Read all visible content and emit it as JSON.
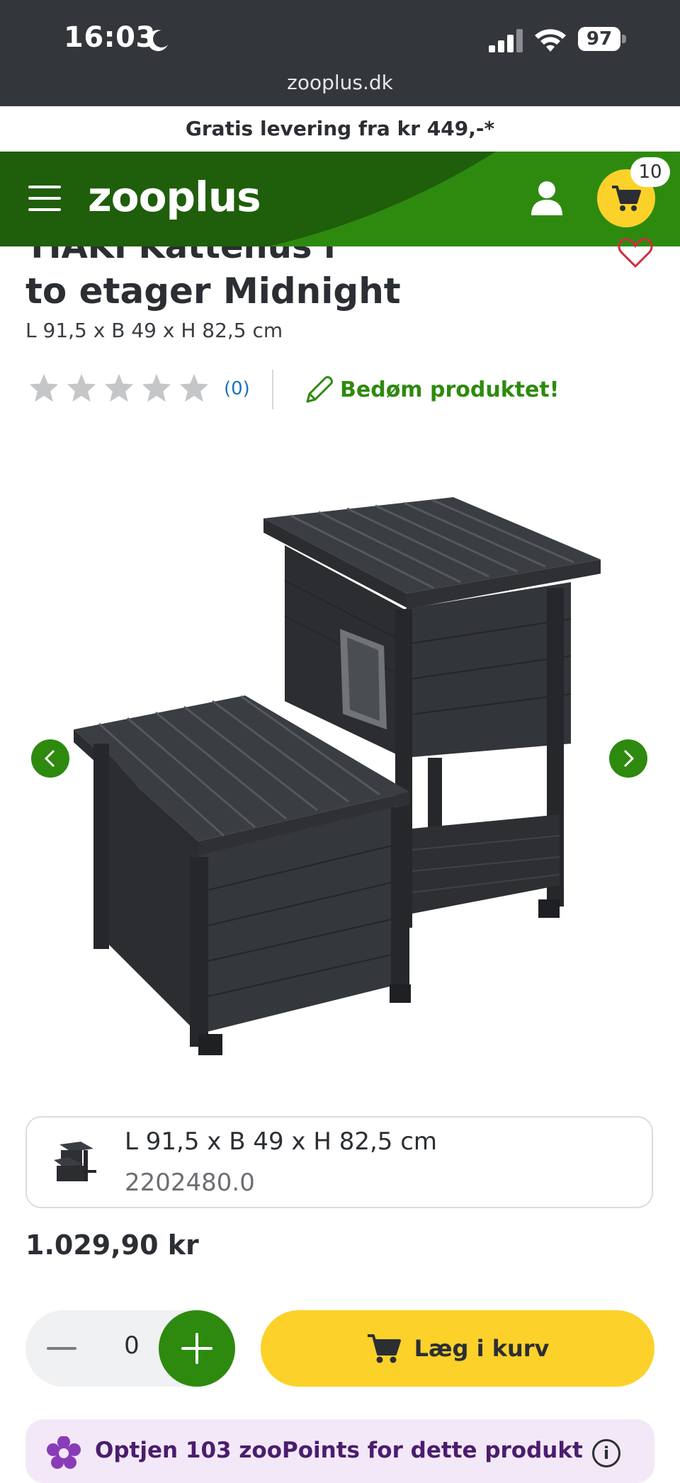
{
  "status_bar": {
    "time": "16:03",
    "battery": "97",
    "url": "zooplus.dk"
  },
  "promo": {
    "text": "Gratis levering fra kr 449,-*"
  },
  "header": {
    "logo": "zooplus",
    "cart_count": "10",
    "brand_green": "#2e8a0e",
    "brand_yellow": "#fcd12a"
  },
  "product": {
    "title_line1": "TIAKI Kattehus i",
    "title_line2": "to etager Midnight",
    "dimensions": "L 91,5 x B 49 x H 82,5 cm",
    "rating_stars": 0,
    "review_count": "(0)",
    "rate_label": "Bedøm produktet!",
    "price": "1.029,90 kr"
  },
  "variant": {
    "dimensions": "L 91,5 x B 49 x H 82,5 cm",
    "sku": "2202480.0"
  },
  "purchase": {
    "quantity": "0",
    "add_to_cart_label": "Læg i kurv"
  },
  "zoopoints": {
    "text": "Optjen 103 zooPoints for dette produkt",
    "info_icon": "i"
  }
}
